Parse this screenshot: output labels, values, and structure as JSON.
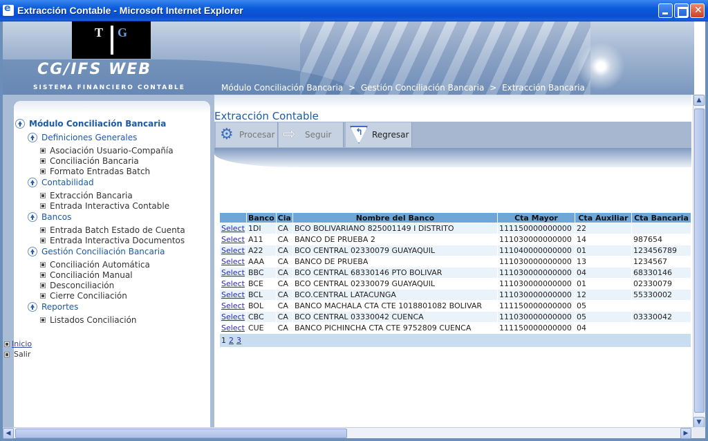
{
  "window": {
    "title": "Extracción Contable - Microsoft Internet Explorer"
  },
  "header": {
    "logo_t": "T",
    "logo_g": "G",
    "brand": "CG/IFS WEB",
    "brand_sub": "SISTEMA FINANCIERO CONTABLE",
    "breadcrumb": [
      "Módulo Conciliación Bancaria",
      ">",
      "Gestión Conciliación Bancaria",
      ">",
      "Extracción Bancaria"
    ]
  },
  "sidebar": {
    "root": "Módulo Conciliación Bancaria",
    "groups": [
      {
        "label": "Definiciones Generales",
        "items": [
          "Asociación Usuario-Compañía",
          "Conciliación Bancaria",
          "Formato Entradas Batch"
        ]
      },
      {
        "label": "Contabilidad",
        "items": [
          "Extracción Bancaria",
          "Entrada Interactiva Contable"
        ]
      },
      {
        "label": "Bancos",
        "items": [
          "Entrada Batch Estado de Cuenta",
          "Entrada Interactiva Documentos"
        ]
      },
      {
        "label": "Gestión Conciliación Bancaria",
        "items": [
          "Conciliación Automática",
          "Conciliación Manual",
          "Desconciliación",
          "Cierre Conciliación"
        ]
      },
      {
        "label": "Reportes",
        "items": [
          "Listados Conciliación"
        ]
      }
    ],
    "inicio": "Inicio",
    "salir": "Salir"
  },
  "main": {
    "title": "Extracción Contable",
    "toolbar": {
      "procesar": "Procesar",
      "seguir": "Seguir",
      "regresar": "Regresar"
    },
    "table": {
      "headers": [
        "",
        "Banco",
        "Cia",
        "Nombre del Banco",
        "Cta Mayor",
        "Cta Auxiliar",
        "Cta Bancaria"
      ],
      "select_label": "Select",
      "rows": [
        [
          "1DI",
          "CA",
          "BCO BOLIVARIANO 825001149 I DISTRITO",
          "111150000000000",
          "22",
          ""
        ],
        [
          "A11",
          "CA",
          "BANCO DE PRUEBA 2",
          "111030000000000",
          "14",
          "987654"
        ],
        [
          "A22",
          "CA",
          "BCO CENTRAL 02330079 GUAYAQUIL",
          "111040000000000",
          "01",
          "123456789"
        ],
        [
          "AAA",
          "CA",
          "BANCO DE PRUEBA",
          "111030000000000",
          "13",
          "1234567"
        ],
        [
          "BBC",
          "CA",
          "BCO CENTRAL 68330146 PTO BOLIVAR",
          "111030000000000",
          "04",
          "68330146"
        ],
        [
          "BCE",
          "CA",
          "BCO CENTRAL 02330079 GUAYAQUIL",
          "111030000000000",
          "01",
          "02330079"
        ],
        [
          "BCL",
          "CA",
          "BCO.CENTRAL LATACUNGA",
          "111030000000000",
          "12",
          "55330002"
        ],
        [
          "BOL",
          "CA",
          "BANCO MACHALA CTA CTE 1018801082 BOLIVAR",
          "111150000000000",
          "05",
          ""
        ],
        [
          "CBC",
          "CA",
          "BCO CENTRAL 03330042 CUENCA",
          "111030000000000",
          "05",
          "03330042"
        ],
        [
          "CUE",
          "CA",
          "BANCO PICHINCHA CTA CTE 9752809 CUENCA",
          "111150000000000",
          "04",
          ""
        ]
      ],
      "pager": {
        "current": "1",
        "pages": [
          "2",
          "3"
        ]
      }
    }
  }
}
